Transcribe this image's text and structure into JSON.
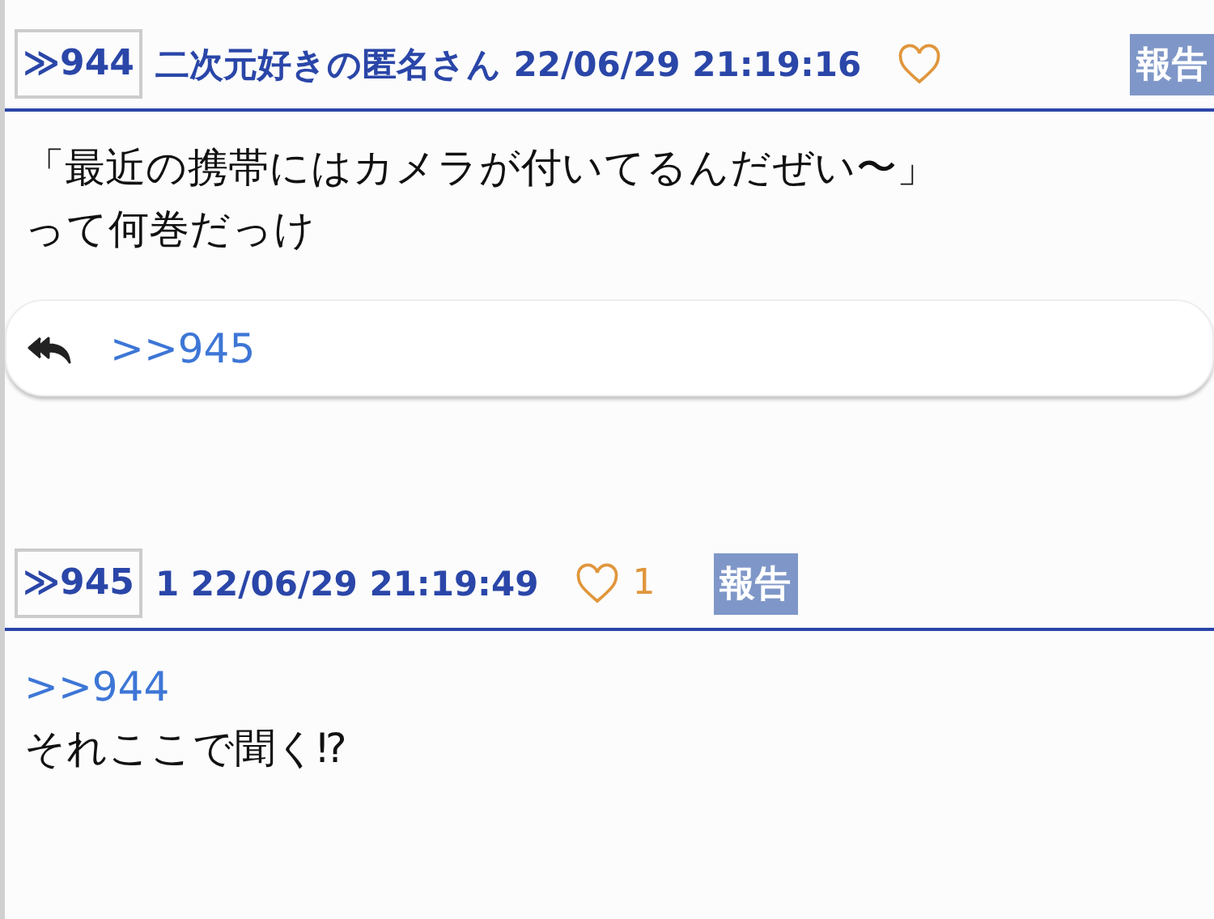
{
  "posts": [
    {
      "number": "≫944",
      "author": "二次元好きの匿名さん",
      "date": "22/06/29 21:19:16",
      "report": "報告",
      "body": {
        "lines": [
          "「最近の携帯にはカメラが付いてるんだぜい〜」",
          "って何巻だっけ"
        ]
      },
      "replies": [
        ">>945"
      ]
    },
    {
      "number": "≫945",
      "author": "1",
      "date": "22/06/29 21:19:49",
      "likes": "1",
      "report": "報告",
      "body": {
        "anchor": ">>944",
        "lines": [
          "それここで聞く⁉"
        ]
      }
    }
  ]
}
